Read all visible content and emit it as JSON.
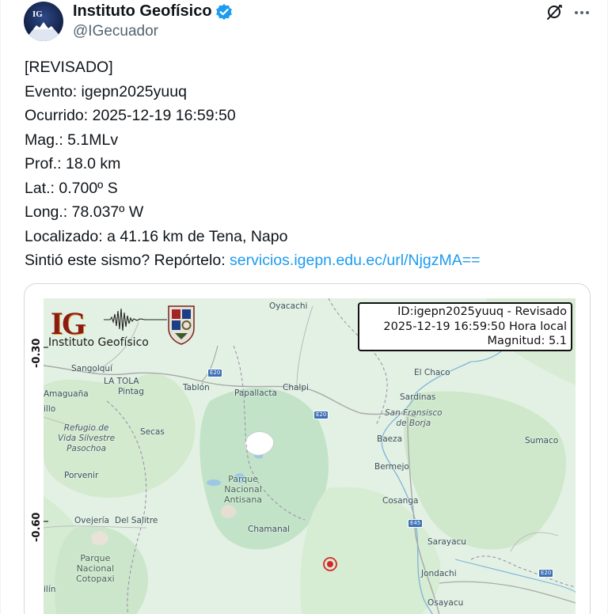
{
  "tweet": {
    "author": {
      "display_name": "Instituto Geofísico",
      "handle": "@IGecuador",
      "avatar_text": "IG",
      "verified": true
    },
    "lines": [
      "[REVISADO]",
      "Evento: igepn2025yuuq",
      "Ocurrido: 2025-12-19 16:59:50",
      "Mag.: 5.1MLv",
      "Prof.: 18.0 km",
      "Lat.: 0.700º S",
      "Long.: 78.037º W",
      "Localizado: a 41.16 km de Tena, Napo"
    ],
    "report_prefix": "Sintió este sismo? Repórtelo: ",
    "report_link": "servicios.igepn.edu.ec/url/NjgzMA=="
  },
  "map": {
    "logo": {
      "letters": "IG",
      "name": "Instituto Geofísico"
    },
    "info_box": {
      "line1": "ID:igepn2025yuuq - Revisado",
      "line2": "2025-12-19 16:59:50 Hora local",
      "line3": "Magnitud: 5.1"
    },
    "y_ticks": [
      "-0.30",
      "-0.60"
    ],
    "places": {
      "oyacachi": "Oyacachi",
      "sangolqui": "Sangolquí",
      "la_tola": "LA TOLA",
      "pintag": "Pintag",
      "amaguana": "Amaguaña",
      "tablon": "Tablón",
      "papallacta": "Papallacta",
      "chalpi": "Chalpi",
      "el_chaco": "El Chaco",
      "sardinas": "Sardinas",
      "san_francisco": "San Fransisco\nde Borja",
      "refugio": "Refugio de\nVida Silvestre\nPasochoa",
      "secas": "Secas",
      "baeza": "Baeza",
      "sumaco": "Sumaco",
      "bermejo": "Bermejo",
      "porvenir": "Porvenir",
      "antisana": "Parque\nNacional\nAntisana",
      "cosanga": "Cosanga",
      "ovejeria": "Ovejería",
      "del_salitre": "Del Salitre",
      "chamanal": "Chamanal",
      "sarayacu": "Sarayacu",
      "cotopaxi": "Parque\nNacional\nCotopaxi",
      "jondachi": "Jondachi",
      "osayacu": "Osayacu",
      "illo": "illo",
      "ilin": "ilín"
    },
    "road_shields": [
      "E20",
      "E20",
      "E45",
      "E20"
    ],
    "epicenter_color": "#d62728"
  },
  "colors": {
    "link": "#1d9bf0",
    "verified": "#1d9bf0",
    "map_base": "#e3f1e4",
    "park": "#c2e3c8",
    "water": "#9cc8e6"
  }
}
